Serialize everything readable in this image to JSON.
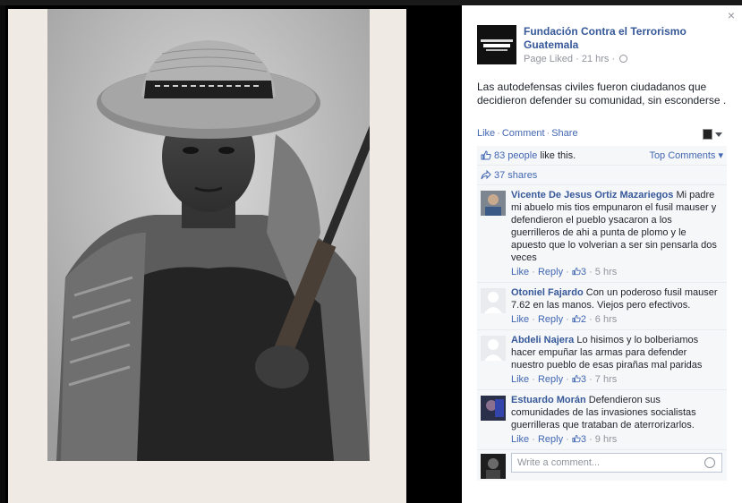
{
  "page": {
    "name": "Fundación Contra el Terrorismo Guatemala",
    "status": "Page Liked",
    "time": "21 hrs"
  },
  "post": {
    "text": "Las autodefensas civiles fueron ciudadanos que decidieron defender su comunidad, sin esconderse ."
  },
  "actions": {
    "like": "Like",
    "comment": "Comment",
    "share": "Share"
  },
  "feedback": {
    "likes_count": "83 people",
    "likes_suffix": " like this.",
    "top_comments": "Top Comments",
    "shares": "37 shares"
  },
  "comments": [
    {
      "author": "Vicente De Jesus Ortiz Mazariegos",
      "text": "Mi padre mi abuelo mis tios empunaron el fusil mauser y defendieron el pueblo ysacaron a los guerrilleros de ahi a punta de plomo y le apuesto que lo volverian a ser sin pensarla dos veces",
      "like": "Like",
      "reply": "Reply",
      "likes": "3",
      "time": "5 hrs"
    },
    {
      "author": "Otoniel Fajardo",
      "text": "Con un poderoso fusil mauser 7.62 en las manos. Viejos pero efectivos.",
      "like": "Like",
      "reply": "Reply",
      "likes": "2",
      "time": "6 hrs"
    },
    {
      "author": "Abdeli Najera",
      "text": "Lo hisimos y lo bolberiamos hacer empuñar las armas para defender nuestro pueblo de esas pirañas mal paridas",
      "like": "Like",
      "reply": "Reply",
      "likes": "3",
      "time": "7 hrs"
    },
    {
      "author": "Estuardo Morán",
      "text": "Defendieron sus comunidades de las invasiones socialistas guerrilleras que trataban de aterrorizarlos.",
      "like": "Like",
      "reply": "Reply",
      "likes": "3",
      "time": "9 hrs"
    }
  ],
  "composer": {
    "placeholder": "Write a comment..."
  },
  "close": "×",
  "colors": {
    "link": "#4267b2",
    "name": "#365899",
    "meta": "#90949c",
    "panel_bg": "#f6f7f9"
  }
}
